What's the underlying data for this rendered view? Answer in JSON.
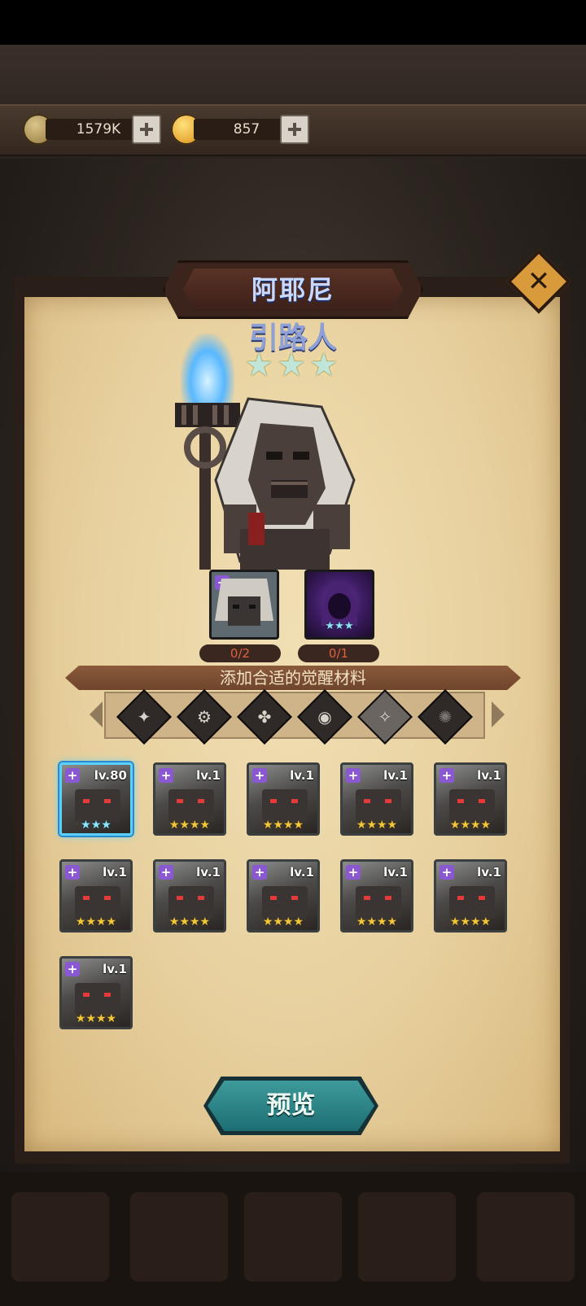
{
  "resources": {
    "gold": {
      "amount": "1579K",
      "icon": "gold-coin-icon"
    },
    "gems": {
      "amount": "857",
      "icon": "gem-coin-icon"
    }
  },
  "hero": {
    "name": "阿耶尼",
    "title": "引路人",
    "stars": "★★★",
    "star_count": 3
  },
  "materials": {
    "slot1": {
      "count": "0/2",
      "stars": ""
    },
    "slot2": {
      "count": "0/1",
      "stars": "★★★"
    }
  },
  "hint": "添加合适的觉醒材料",
  "filters": [
    "all-factions-icon",
    "faction-gear-icon",
    "faction-clover-icon",
    "faction-eye-icon",
    "faction-light-icon",
    "faction-dark-icon"
  ],
  "cards": [
    {
      "level": "lv.80",
      "stars": "★★★",
      "selected": true
    },
    {
      "level": "lv.1",
      "stars": "★★★★"
    },
    {
      "level": "lv.1",
      "stars": "★★★★"
    },
    {
      "level": "lv.1",
      "stars": "★★★★"
    },
    {
      "level": "lv.1",
      "stars": "★★★★"
    },
    {
      "level": "lv.1",
      "stars": "★★★★"
    },
    {
      "level": "lv.1",
      "stars": "★★★★"
    },
    {
      "level": "lv.1",
      "stars": "★★★★"
    },
    {
      "level": "lv.1",
      "stars": "★★★★"
    },
    {
      "level": "lv.1",
      "stars": "★★★★"
    },
    {
      "level": "lv.1",
      "stars": "★★★★"
    }
  ],
  "preview_button": "预览",
  "colors": {
    "accent": "#3e9a9a",
    "parchment": "#e7d09e",
    "selected": "#5ad0ff"
  }
}
